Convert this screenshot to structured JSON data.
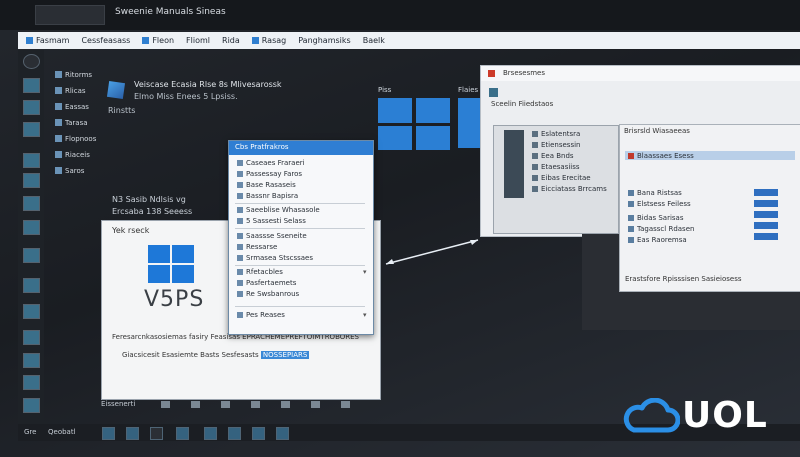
{
  "topbar": {
    "title": "Sweenie Manuals Sineas"
  },
  "menubar": {
    "items": [
      "Fasmam",
      "Cessfeasass",
      "Fleon",
      "Flioml",
      "Rida",
      "Rasag",
      "Panghamsiks",
      "Baelk"
    ]
  },
  "left_nav": {
    "items": [
      "Ritorms",
      "Rlicas",
      "Eassas",
      "Tarasa",
      "Flopnoos",
      "Riaceis",
      "Saros"
    ]
  },
  "info1": {
    "title": "Veiscase Ecasia Rlse 8s Mlivesarossk",
    "subtitle": "Elmo Miss Enees 5 Lpsiss.",
    "note": "Rinstts"
  },
  "info2": {
    "line1": "N3 Sasib Ndlsis vg",
    "line2": "Ercsaba 138 Seeess"
  },
  "tiles": {
    "label_a": "Piss",
    "label_b": "Flaies"
  },
  "vps_window": {
    "header": "Yek rseck",
    "big_text": "V5PS",
    "line1": "Feresarcnkasosiemas fasiry Feasisas EPRACHEMEPREFTOIMTROBORES",
    "line2_a": "Giacsicesit Esasiemte Basts Sesfesasts",
    "line2_b": "NOSSEPIARS"
  },
  "dropdown": {
    "title": "Cbs Pratfrakros",
    "items": [
      "Caseaes Fraraeri",
      "Passessay Faros",
      "Base Rasaseis",
      "Bassnr Bapisra",
      "Saeeblise Whasasole",
      "5 Sassesti Selass",
      "Saassse Sseneite",
      "Ressarse",
      "Srmasea Stscssaes",
      "Rfetacbles",
      "Pasfertaemets",
      "Re Swsbanrous",
      "Pes Reases"
    ]
  },
  "win2": {
    "title": "Brsesesmes",
    "label": "Sceelin Fiiedstaos"
  },
  "gpanel": {
    "items": [
      "Eslatentsra",
      "Etiensessin",
      "Eea Bnds",
      "Etaesasiiss",
      "Eibas Erecitae",
      "Eicciatass Brrcams"
    ]
  },
  "rwin": {
    "header": "Brisrsld Wiasaeeas",
    "selected": "Blaassaes Esess",
    "rows": [
      "Bana Ristsas",
      "Elstsess Feiless",
      "Bidas Sarisas",
      "Tagasscl Rdasen",
      "Eas Raoremsa"
    ],
    "footer": "Erastsfore Rpisssisen Sasieiosess"
  },
  "vpsbar": {
    "label": "Eissenerti"
  },
  "taskbar": {
    "left_a": "Gre",
    "left_b": "Qeobatl"
  },
  "logo": {
    "text": "UOL"
  }
}
